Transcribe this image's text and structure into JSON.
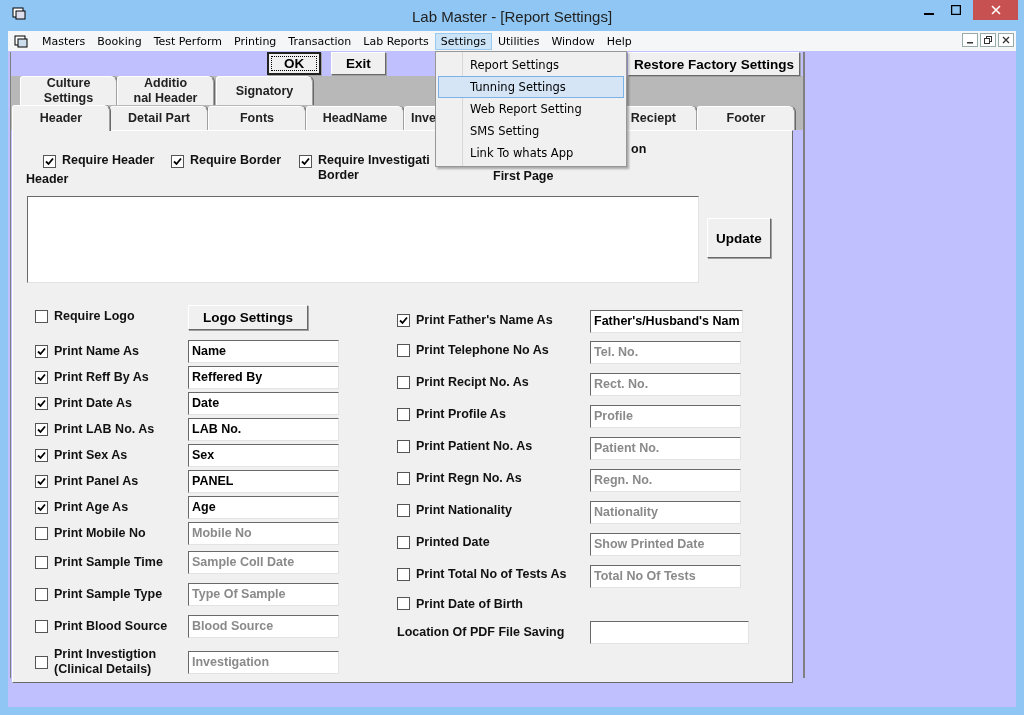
{
  "window": {
    "title": "Lab Master - [Report Settings]"
  },
  "menu_bar": [
    {
      "label": "Masters",
      "selected": false
    },
    {
      "label": "Booking",
      "selected": false
    },
    {
      "label": "Test Perform",
      "selected": false
    },
    {
      "label": "Printing",
      "selected": false
    },
    {
      "label": "Transaction",
      "selected": false
    },
    {
      "label": "Lab Reports",
      "selected": false
    },
    {
      "label": "Settings",
      "selected": true
    },
    {
      "label": "Utilities",
      "selected": false
    },
    {
      "label": "Window",
      "selected": false
    },
    {
      "label": "Help",
      "selected": false
    }
  ],
  "dropdown": [
    {
      "label": "Report Settings",
      "selected": false
    },
    {
      "label": "Tunning Settings",
      "selected": true
    },
    {
      "label": "Web Report Setting",
      "selected": false
    },
    {
      "label": "SMS Setting",
      "selected": false
    },
    {
      "label": "Link To whats App",
      "selected": false
    }
  ],
  "buttons": [
    {
      "label": "OK",
      "focused": true
    },
    {
      "label": "Exit",
      "focused": false
    },
    {
      "label": "Restore Factory Settings",
      "focused": false
    }
  ],
  "upper_tabs": [
    {
      "label": "Culture\nSettings",
      "selected": false
    },
    {
      "label": "Additio\nnal Header",
      "selected": false
    },
    {
      "label": "Signatory",
      "selected": false
    }
  ],
  "lower_tabs": [
    {
      "label": "Header",
      "selected": true
    },
    {
      "label": "Detail Part",
      "selected": false
    },
    {
      "label": "Fonts",
      "selected": false
    },
    {
      "label": "HeadName",
      "selected": false
    },
    {
      "label": "Inve",
      "selected": false
    },
    {
      "label": "Reciept",
      "selected": false
    },
    {
      "label": "Footer",
      "selected": false
    }
  ],
  "header_options": [
    {
      "label": "Require Header",
      "checked": true
    },
    {
      "label": "Require Border",
      "checked": true
    },
    {
      "label": "Require Investigati\nBorder",
      "checked": true
    }
  ],
  "covered_option": {
    "line_1": "on",
    "line_2": "First Page"
  },
  "header_label": "Header",
  "update_button": "Update",
  "logo": {
    "label": "Require Logo",
    "checked": false,
    "button": "Logo Settings"
  },
  "left_fields": [
    {
      "label": "Print Name As",
      "checked": true,
      "value": "Name"
    },
    {
      "label": "Print Reff By As",
      "checked": true,
      "value": "Reffered By"
    },
    {
      "label": "Print Date As",
      "checked": true,
      "value": "Date"
    },
    {
      "label": "Print LAB No. As",
      "checked": true,
      "value": "LAB No."
    },
    {
      "label": "Print Sex As",
      "checked": true,
      "value": "Sex"
    },
    {
      "label": "Print Panel As",
      "checked": true,
      "value": "PANEL"
    },
    {
      "label": "Print Age As",
      "checked": true,
      "value": "Age"
    },
    {
      "label": "Print Mobile No",
      "checked": false,
      "value": "Mobile No"
    },
    {
      "label": "Print Sample Time",
      "checked": false,
      "value": "Sample Coll Date"
    },
    {
      "label": "Print Sample Type",
      "checked": false,
      "value": "Type Of Sample"
    },
    {
      "label": "Print Blood Source",
      "checked": false,
      "value": "Blood Source"
    },
    {
      "label": "Print Investigtion\n(Clinical Details)",
      "checked": false,
      "value": "Investigation"
    }
  ],
  "right_fields": [
    {
      "kind": "check-field",
      "label": "Print Father's Name As",
      "checked": true,
      "value": "Father's/Husband's Nam"
    },
    {
      "kind": "check-field",
      "label": "Print Telephone No As",
      "checked": false,
      "value": "Tel. No."
    },
    {
      "kind": "check-field",
      "label": "Print Recipt No. As",
      "checked": false,
      "value": "Rect. No."
    },
    {
      "kind": "check-field",
      "label": "Print Profile As",
      "checked": false,
      "value": "Profile"
    },
    {
      "kind": "check-field",
      "label": "Print Patient No. As",
      "checked": false,
      "value": "Patient No."
    },
    {
      "kind": "check-field",
      "label": "Print Regn No. As",
      "checked": false,
      "value": "Regn. No."
    },
    {
      "kind": "check-field",
      "label": "Print Nationality",
      "checked": false,
      "value": "Nationality"
    },
    {
      "kind": "check-field",
      "label": "Printed Date",
      "checked": false,
      "value": "Show Printed Date"
    },
    {
      "kind": "check-field",
      "label": "Print Total No of Tests As",
      "checked": false,
      "value": "Total No Of Tests"
    },
    {
      "kind": "check",
      "label": "Print Date of Birth",
      "checked": false
    },
    {
      "kind": "text-field",
      "label": "Location Of PDF File Saving"
    }
  ]
}
